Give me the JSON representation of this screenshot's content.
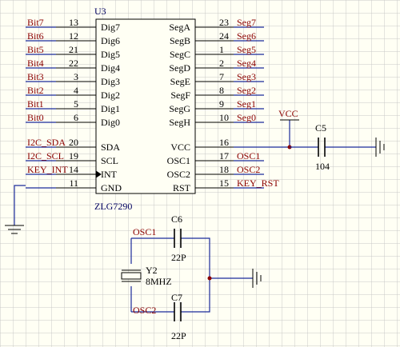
{
  "chip": {
    "designator": "U3",
    "part": "ZLG7290",
    "left_pins": [
      {
        "net": "Bit7",
        "num": "13",
        "name": "Dig7"
      },
      {
        "net": "Bit6",
        "num": "12",
        "name": "Dig6"
      },
      {
        "net": "Bit5",
        "num": "21",
        "name": "Dig5"
      },
      {
        "net": "Bit4",
        "num": "22",
        "name": "Dig4"
      },
      {
        "net": "Bit3",
        "num": "3",
        "name": "Dig3"
      },
      {
        "net": "Bit2",
        "num": "4",
        "name": "Dig2"
      },
      {
        "net": "Bit1",
        "num": "5",
        "name": "Dig1"
      },
      {
        "net": "Bit0",
        "num": "6",
        "name": "Dig0"
      },
      {
        "net": "I2C_SDA",
        "num": "20",
        "name": "SDA"
      },
      {
        "net": "I2C_SCL",
        "num": "19",
        "name": "SCL"
      },
      {
        "net": "KEY_INT",
        "num": "14",
        "name": "INT"
      },
      {
        "net": "",
        "num": "11",
        "name": "GND"
      }
    ],
    "right_pins": [
      {
        "name": "SegA",
        "num": "23",
        "net": "Seg7"
      },
      {
        "name": "SegB",
        "num": "24",
        "net": "Seg6"
      },
      {
        "name": "SegC",
        "num": "1",
        "net": "Seg5"
      },
      {
        "name": "SegD",
        "num": "2",
        "net": "Seg4"
      },
      {
        "name": "SegE",
        "num": "7",
        "net": "Seg3"
      },
      {
        "name": "SegF",
        "num": "8",
        "net": "Seg2"
      },
      {
        "name": "SegG",
        "num": "9",
        "net": "Seg1"
      },
      {
        "name": "SegH",
        "num": "10",
        "net": "Seg0"
      },
      {
        "name": "VCC",
        "num": "16",
        "net": ""
      },
      {
        "name": "OSC1",
        "num": "17",
        "net": "OSC1"
      },
      {
        "name": "OSC2",
        "num": "18",
        "net": "OSC2"
      },
      {
        "name": "RST",
        "num": "15",
        "net": "KEY_RST"
      }
    ]
  },
  "power": {
    "vcc": "VCC"
  },
  "c5": {
    "designator": "C5",
    "value": "104"
  },
  "c6": {
    "designator": "C6",
    "value": "22P",
    "net": "OSC1"
  },
  "c7": {
    "designator": "C7",
    "value": "22P",
    "net": "OSC2"
  },
  "y2": {
    "designator": "Y2",
    "value": "8MHZ"
  },
  "colors": {
    "background": "#fffff4",
    "grid": "#c8c8c8",
    "wire": "#1a2a9a",
    "net_label": "#8b0000"
  }
}
